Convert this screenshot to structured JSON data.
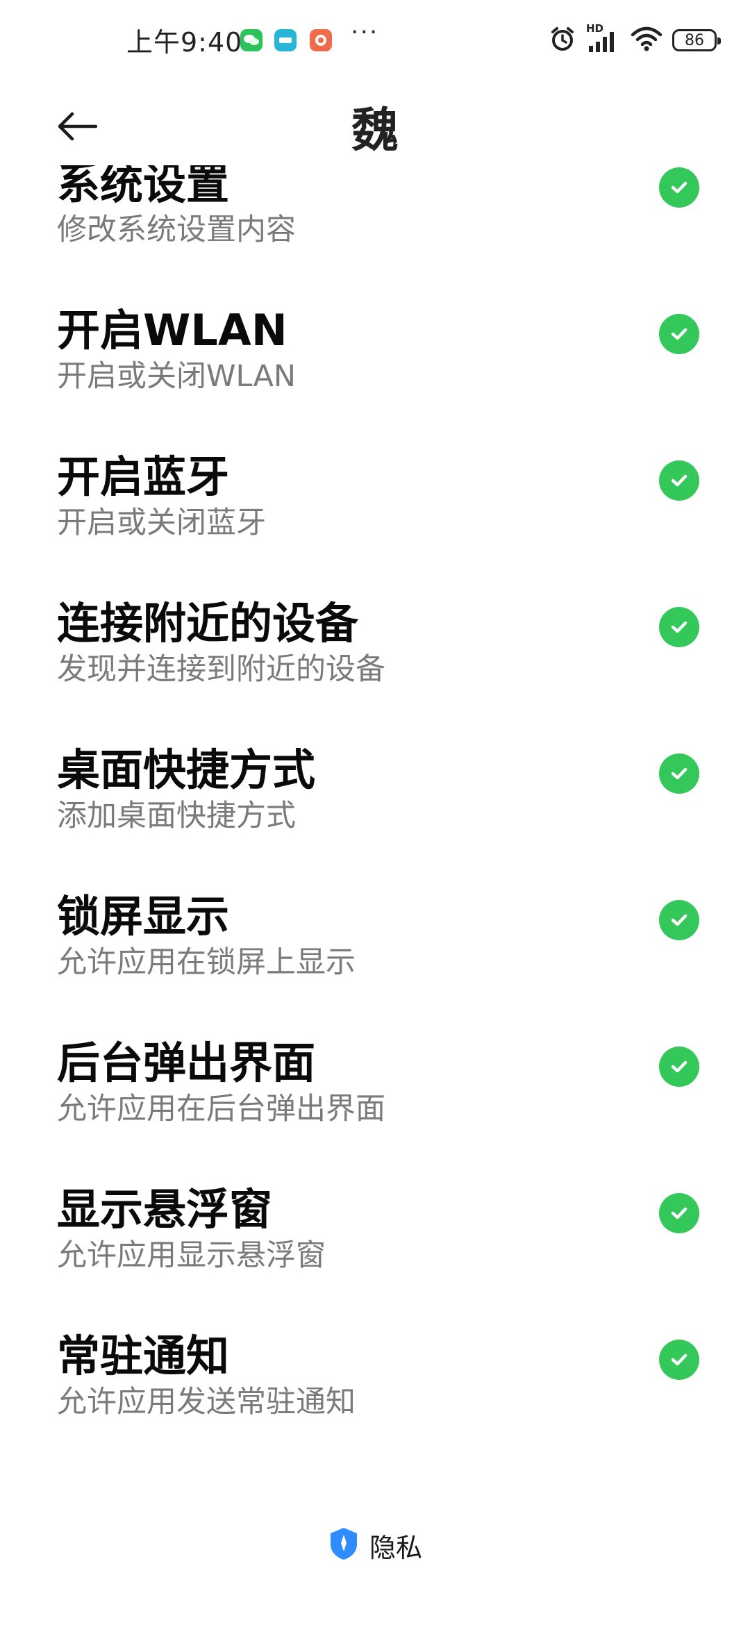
{
  "status_bar": {
    "time": "上午9:40",
    "more": "···",
    "network_badge": "HD",
    "battery_level": "86",
    "icons": [
      "wechat-icon",
      "app-notification-icon",
      "app-notification-icon-2",
      "alarm-icon",
      "signal-icon",
      "wifi-icon",
      "battery-icon"
    ]
  },
  "app_bar": {
    "title": "魏",
    "back_icon": "back-arrow-icon"
  },
  "permissions": [
    {
      "title": "系统设置",
      "subtitle": "修改系统设置内容",
      "granted": true
    },
    {
      "title": "开启WLAN",
      "subtitle": "开启或关闭WLAN",
      "granted": true
    },
    {
      "title": "开启蓝牙",
      "subtitle": "开启或关闭蓝牙",
      "granted": true
    },
    {
      "title": "连接附近的设备",
      "subtitle": "发现并连接到附近的设备",
      "granted": true
    },
    {
      "title": "桌面快捷方式",
      "subtitle": "添加桌面快捷方式",
      "granted": true
    },
    {
      "title": "锁屏显示",
      "subtitle": "允许应用在锁屏上显示",
      "granted": true
    },
    {
      "title": "后台弹出界面",
      "subtitle": "允许应用在后台弹出界面",
      "granted": true
    },
    {
      "title": "显示悬浮窗",
      "subtitle": "允许应用显示悬浮窗",
      "granted": true
    },
    {
      "title": "常驻通知",
      "subtitle": "允许应用发送常驻通知",
      "granted": true
    }
  ],
  "footer": {
    "label": "隐私",
    "icon": "privacy-shield-icon"
  },
  "colors": {
    "check": "#34c759",
    "title_text": "#0a0a0a",
    "subtitle_text": "#7a7a7a",
    "privacy_icon": "#2f8cff"
  }
}
